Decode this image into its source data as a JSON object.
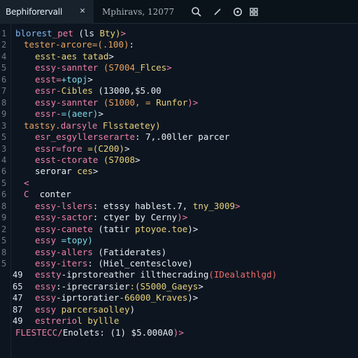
{
  "tabs": [
    {
      "label": "Bephiforervall",
      "close": "✕"
    },
    {
      "label": "Mphiravs, 12077"
    }
  ],
  "toolbar": {
    "icons": [
      "search-icon",
      "pencil-icon",
      "settings-icon",
      "extensions-icon"
    ]
  },
  "lines": [
    {
      "num": "1",
      "bright": false,
      "indent": 22,
      "parts": [
        {
          "t": "blorest",
          "c": "c-blue"
        },
        {
          "t": "_pet ",
          "c": "c-pink"
        },
        {
          "t": "(ls ",
          "c": "c-white"
        },
        {
          "t": "Bty)",
          "c": "c-yellow"
        },
        {
          "t": ">",
          "c": "c-pink"
        }
      ]
    },
    {
      "num": "2",
      "bright": false,
      "indent": 34,
      "parts": [
        {
          "t": "tester-arcore=(.100)",
          "c": "c-orange"
        },
        {
          "t": ":",
          "c": "c-white"
        }
      ]
    },
    {
      "num": "4",
      "bright": false,
      "indent": 50,
      "parts": [
        {
          "t": "esst-aes ",
          "c": "c-yellow"
        },
        {
          "t": "tatad",
          "c": "c-yellow"
        },
        {
          "t": ">",
          "c": "c-white"
        }
      ]
    },
    {
      "num": "5",
      "bright": false,
      "indent": 50,
      "parts": [
        {
          "t": "essy-sannter ",
          "c": "c-pink"
        },
        {
          "t": "(S7004_",
          "c": "c-orange"
        },
        {
          "t": "Flces",
          "c": "c-yellow"
        },
        {
          "t": ">",
          "c": "c-pink"
        }
      ]
    },
    {
      "num": "6",
      "bright": false,
      "indent": 50,
      "parts": [
        {
          "t": "esst=",
          "c": "c-pink"
        },
        {
          "t": "+topj",
          "c": "c-cyan"
        },
        {
          "t": ">",
          "c": "c-white"
        }
      ]
    },
    {
      "num": "7",
      "bright": false,
      "indent": 50,
      "parts": [
        {
          "t": "essr-",
          "c": "c-pink"
        },
        {
          "t": "Cibles ",
          "c": "c-yellow"
        },
        {
          "t": "(13000,$5.00",
          "c": "c-white"
        }
      ]
    },
    {
      "num": "8",
      "bright": false,
      "indent": 50,
      "parts": [
        {
          "t": "essy-sannter ",
          "c": "c-pink"
        },
        {
          "t": "(S1000, = ",
          "c": "c-orange"
        },
        {
          "t": "Runfor",
          "c": "c-yellow"
        },
        {
          "t": ")>",
          "c": "c-pink"
        }
      ]
    },
    {
      "num": "9",
      "bright": false,
      "indent": 50,
      "parts": [
        {
          "t": "essr-",
          "c": "c-pink"
        },
        {
          "t": "=(aeer)",
          "c": "c-cyan"
        },
        {
          "t": ">",
          "c": "c-white"
        }
      ]
    },
    {
      "num": "3",
      "bright": false,
      "indent": 34,
      "parts": [
        {
          "t": "tastsy.",
          "c": "c-orange"
        },
        {
          "t": "darsyle ",
          "c": "c-pink"
        },
        {
          "t": "Flsstaetey)",
          "c": "c-yellow"
        }
      ]
    },
    {
      "num": "5",
      "bright": false,
      "indent": 50,
      "parts": [
        {
          "t": "esr_esgyllerserarte",
          "c": "c-pink"
        },
        {
          "t": ": 7,.00ller parcer",
          "c": "c-white"
        }
      ]
    },
    {
      "num": "3",
      "bright": false,
      "indent": 50,
      "parts": [
        {
          "t": "essr=fore ",
          "c": "c-pink"
        },
        {
          "t": "=(C200)",
          "c": "c-yellow"
        },
        {
          "t": ">",
          "c": "c-white"
        }
      ]
    },
    {
      "num": "4",
      "bright": false,
      "indent": 50,
      "parts": [
        {
          "t": "esst-ctorate ",
          "c": "c-pink"
        },
        {
          "t": "(S7008",
          "c": "c-yellow"
        },
        {
          "t": ">",
          "c": "c-white"
        }
      ]
    },
    {
      "num": "6",
      "bright": false,
      "indent": 50,
      "parts": [
        {
          "t": "serorar ",
          "c": "c-white"
        },
        {
          "t": "ces",
          "c": "c-yellow"
        },
        {
          "t": ">",
          "c": "c-white"
        }
      ]
    },
    {
      "num": "5",
      "bright": false,
      "indent": 34,
      "parts": [
        {
          "t": "<",
          "c": "c-pink"
        }
      ]
    },
    {
      "num": "6",
      "bright": false,
      "indent": 34,
      "parts": [
        {
          "t": "C  ",
          "c": "c-pink"
        },
        {
          "t": "conter",
          "c": "c-white"
        }
      ]
    },
    {
      "num": "8",
      "bright": false,
      "indent": 50,
      "parts": [
        {
          "t": "essy-lslers",
          "c": "c-pink"
        },
        {
          "t": ": etssy hablest.7, ",
          "c": "c-white"
        },
        {
          "t": "tny_3009",
          "c": "c-yellow"
        },
        {
          "t": ">",
          "c": "c-pink"
        }
      ]
    },
    {
      "num": "9",
      "bright": false,
      "indent": 50,
      "parts": [
        {
          "t": "essy-sactor",
          "c": "c-pink"
        },
        {
          "t": ": ctyer by Cerny",
          "c": "c-white"
        },
        {
          "t": ")>",
          "c": "c-pink"
        }
      ]
    },
    {
      "num": "2",
      "bright": false,
      "indent": 50,
      "parts": [
        {
          "t": "essy-canete ",
          "c": "c-pink"
        },
        {
          "t": "(tatir ",
          "c": "c-white"
        },
        {
          "t": "ptoyoe.toe",
          "c": "c-yellow"
        },
        {
          "t": ")>",
          "c": "c-white"
        }
      ]
    },
    {
      "num": "5",
      "bright": false,
      "indent": 50,
      "parts": [
        {
          "t": "essy ",
          "c": "c-pink"
        },
        {
          "t": "=topy)",
          "c": "c-cyan"
        }
      ]
    },
    {
      "num": "8",
      "bright": false,
      "indent": 50,
      "parts": [
        {
          "t": "essy-allers ",
          "c": "c-pink"
        },
        {
          "t": "(Fatiderates)",
          "c": "c-white"
        }
      ]
    },
    {
      "num": "5",
      "bright": false,
      "indent": 50,
      "parts": [
        {
          "t": "essy-iters",
          "c": "c-pink"
        },
        {
          "t": ": ",
          "c": "c-white"
        },
        {
          "t": "(Hiel_centesclove)",
          "c": "c-white"
        }
      ]
    },
    {
      "num": "49",
      "bright": true,
      "indent": 50,
      "parts": [
        {
          "t": "essty",
          "c": "c-pink"
        },
        {
          "t": "-iprstoreather ",
          "c": "c-white"
        },
        {
          "t": "illthecrading",
          "c": "c-white"
        },
        {
          "t": "(IDealathlgd)",
          "c": "c-red"
        }
      ]
    },
    {
      "num": "65",
      "bright": true,
      "indent": 50,
      "parts": [
        {
          "t": "essy",
          "c": "c-pink"
        },
        {
          "t": ":-iprecrarsier",
          "c": "c-white"
        },
        {
          "t": ":(S5000_Gaeys",
          "c": "c-yellow"
        },
        {
          "t": ">",
          "c": "c-white"
        }
      ]
    },
    {
      "num": "47",
      "bright": true,
      "indent": 50,
      "parts": [
        {
          "t": "essy",
          "c": "c-pink"
        },
        {
          "t": "-iprtoratier",
          "c": "c-white"
        },
        {
          "t": "-66000_Kraves",
          "c": "c-yellow"
        },
        {
          "t": ")>",
          "c": "c-white"
        }
      ]
    },
    {
      "num": "87",
      "bright": true,
      "indent": 50,
      "parts": [
        {
          "t": "essy ",
          "c": "c-pink"
        },
        {
          "t": "parcersaolley",
          "c": "c-yellow"
        },
        {
          "t": ")",
          "c": "c-white"
        }
      ]
    },
    {
      "num": "49",
      "bright": true,
      "indent": 50,
      "parts": [
        {
          "t": "estrerio",
          "c": "c-pink"
        },
        {
          "t": "l byllle",
          "c": "c-yellow"
        }
      ]
    },
    {
      "num": "",
      "bright": false,
      "indent": 22,
      "parts": [
        {
          "t": "FLESTECC/",
          "c": "c-pink"
        },
        {
          "t": "Enolets",
          "c": "c-white"
        },
        {
          "t": ": (1) ",
          "c": "c-white"
        },
        {
          "t": "$5.000A0",
          "c": "c-white"
        },
        {
          "t": ")>",
          "c": "c-pink"
        }
      ]
    }
  ]
}
